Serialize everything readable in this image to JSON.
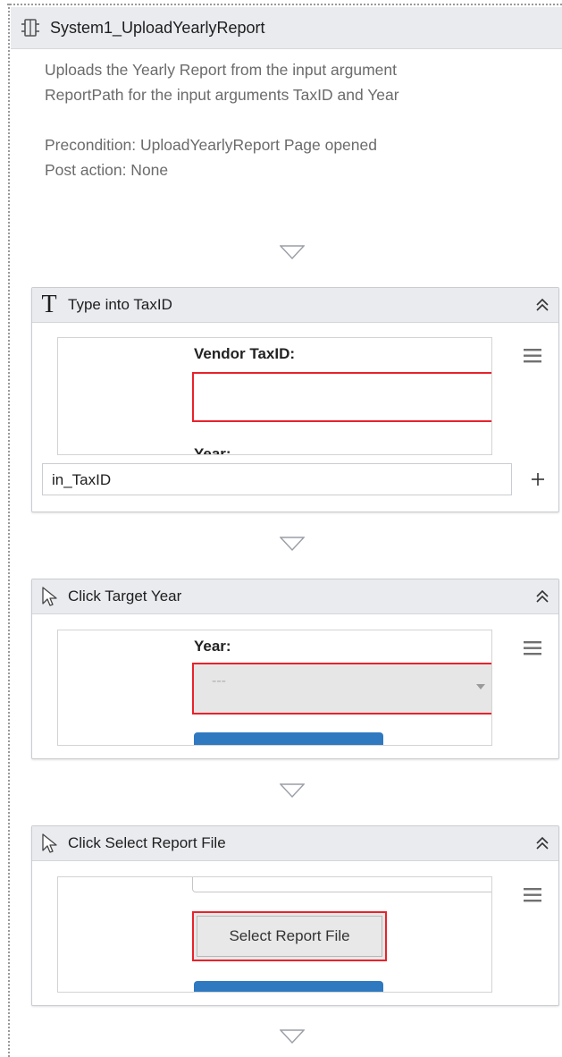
{
  "sequence": {
    "title": "System1_UploadYearlyReport",
    "description": [
      "Uploads the Yearly Report from the input argument",
      "ReportPath for the input arguments TaxID and Year"
    ],
    "precondition": "Precondition: UploadYearlyReport Page opened",
    "post_action": "Post action: None"
  },
  "activities": [
    {
      "title": "Type into TaxID",
      "icon": "type-into-icon",
      "preview": {
        "label": "Vendor TaxID:",
        "cut_label": "Year:"
      },
      "input_value": "in_TaxID"
    },
    {
      "title": "Click Target Year",
      "icon": "click-cursor-icon",
      "preview": {
        "label": "Year:",
        "select_value": "---"
      }
    },
    {
      "title": "Click Select Report File",
      "icon": "click-cursor-icon",
      "preview": {
        "button_label": "Select Report File"
      }
    }
  ],
  "colors": {
    "header_bg": "#e9ebef",
    "highlight_red": "#e8222b",
    "blue_button": "#2f79c1",
    "description_gray": "#6b6b6b"
  }
}
